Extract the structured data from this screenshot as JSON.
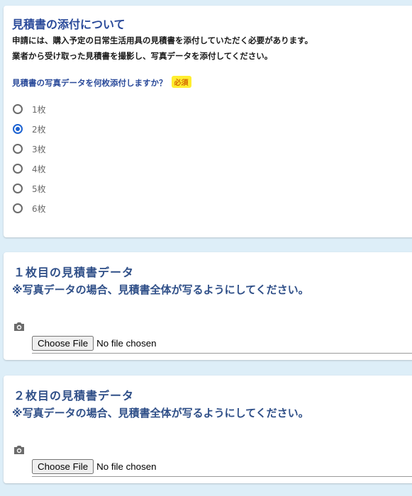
{
  "quote_section": {
    "title": "見積書の添付について",
    "description_line1": "申請には、購入予定の日常生活用具の見積書を添付していただく必要があります。",
    "description_line2": "業者から受け取った見積書を撮影し、写真データを添付してください。",
    "question": "見積書の写真データを何枚添付しますか？",
    "required_label": "必須",
    "options": [
      {
        "label": "1枚",
        "selected": false
      },
      {
        "label": "2枚",
        "selected": true
      },
      {
        "label": "3枚",
        "selected": false
      },
      {
        "label": "4枚",
        "selected": false
      },
      {
        "label": "5枚",
        "selected": false
      },
      {
        "label": "6枚",
        "selected": false
      }
    ]
  },
  "uploads": [
    {
      "title": "１枚目の見積書データ",
      "note": "※写真データの場合、見積書全体が写るようにしてください。",
      "icon": "camera-icon"
    },
    {
      "title": "２枚目の見積書データ",
      "note": "※写真データの場合、見積書全体が写るようにしてください。",
      "icon": "camera-icon"
    }
  ],
  "colors": {
    "background": "#ddeef8",
    "title": "#2a4a9a",
    "radio_selected": "#1d63d2",
    "required_badge_bg": "#ffee30",
    "required_badge_text": "#d36a00"
  }
}
